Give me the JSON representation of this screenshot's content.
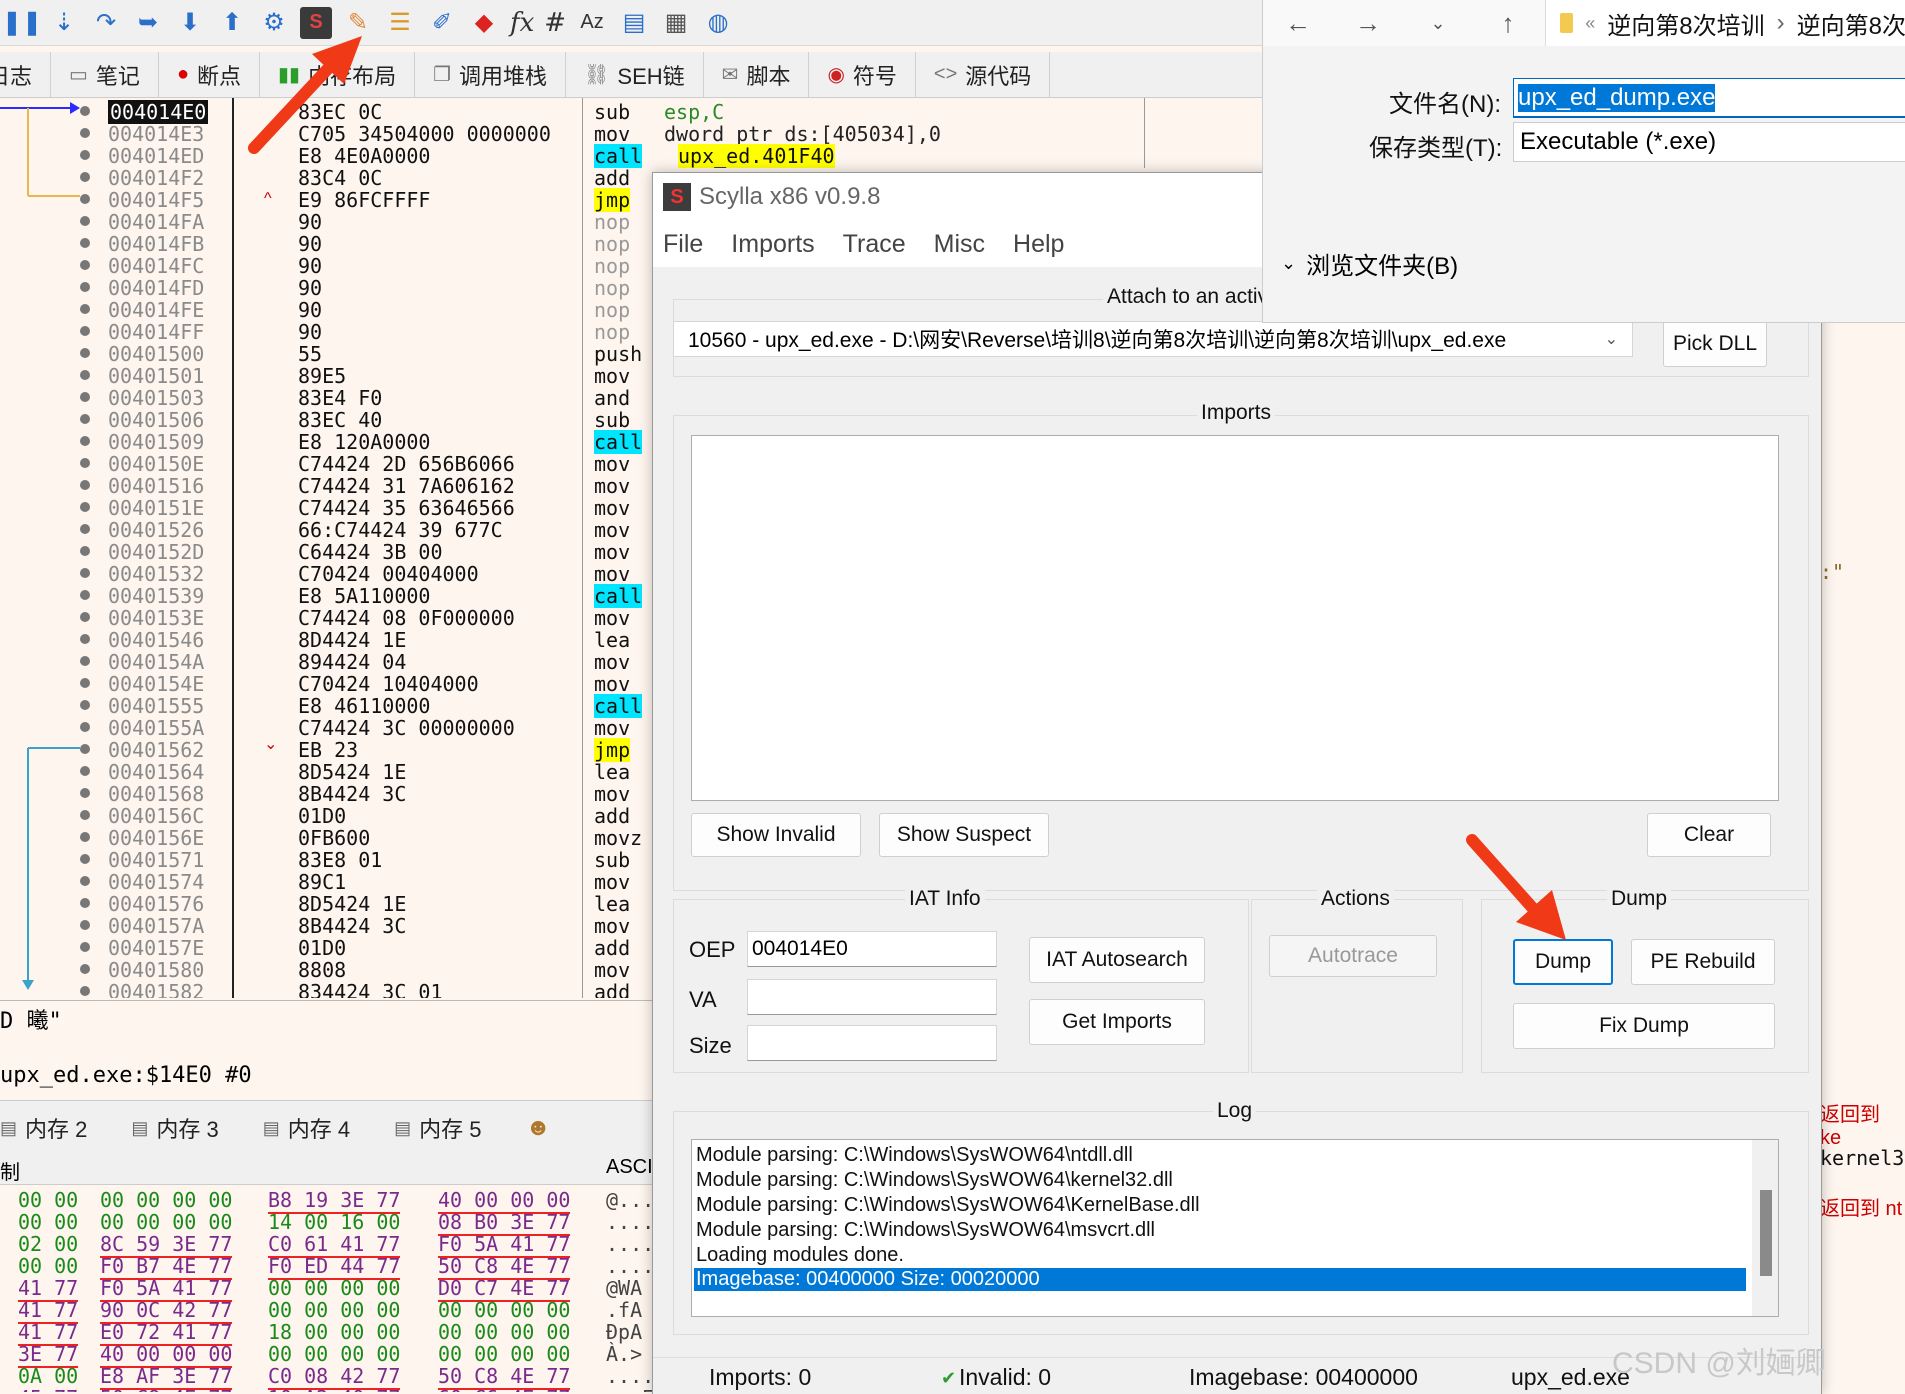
{
  "toolbar": {
    "items": [
      "pause-icon",
      "step-into-icon",
      "step-over-icon",
      "step-out-icon",
      "run-to-user-icon",
      "animate-icon",
      "user-icon",
      "scylla-icon",
      "patch-icon",
      "comment-icon",
      "label-icon",
      "bookmark-icon",
      "function-icon",
      "hash-icon",
      "font-icon",
      "memory-icon",
      "calculator-icon",
      "globe-icon"
    ],
    "fx": "fx",
    "hash": "#",
    "az": "Az"
  },
  "tabs": [
    {
      "icon": "log-icon",
      "label": "日志"
    },
    {
      "icon": "notes-icon",
      "label": "笔记"
    },
    {
      "icon": "breakpoint-icon",
      "label": "断点"
    },
    {
      "icon": "memory-map-icon",
      "label": "内存布局"
    },
    {
      "icon": "callstack-icon",
      "label": "调用堆栈"
    },
    {
      "icon": "seh-icon",
      "label": "SEH链"
    },
    {
      "icon": "script-icon",
      "label": "脚本"
    },
    {
      "icon": "symbol-icon",
      "label": "符号"
    },
    {
      "icon": "source-icon",
      "label": "源代码"
    }
  ],
  "disasm": [
    {
      "addr": "004014E0",
      "bytes": "83EC 0C",
      "mn": "sub",
      "op": "esp,C",
      "hl": ""
    },
    {
      "addr": "004014E3",
      "bytes": "C705 34504000 0000000",
      "mn": "mov",
      "op": "dword ptr ds:[405034],0",
      "hl": ""
    },
    {
      "addr": "004014ED",
      "bytes": "E8 4E0A0000",
      "mn": "call",
      "op": "upx_ed.401F40",
      "hl": "c"
    },
    {
      "addr": "004014F2",
      "bytes": "83C4 0C",
      "mn": "add",
      "op": "",
      "hl": ""
    },
    {
      "addr": "004014F5",
      "bytes": "E9 86FCFFFF",
      "mn": "jmp",
      "op": "",
      "hl": "y"
    },
    {
      "addr": "004014FA",
      "bytes": "90",
      "mn": "nop",
      "op": "",
      "hl": "n"
    },
    {
      "addr": "004014FB",
      "bytes": "90",
      "mn": "nop",
      "op": "",
      "hl": "n"
    },
    {
      "addr": "004014FC",
      "bytes": "90",
      "mn": "nop",
      "op": "",
      "hl": "n"
    },
    {
      "addr": "004014FD",
      "bytes": "90",
      "mn": "nop",
      "op": "",
      "hl": "n"
    },
    {
      "addr": "004014FE",
      "bytes": "90",
      "mn": "nop",
      "op": "",
      "hl": "n"
    },
    {
      "addr": "004014FF",
      "bytes": "90",
      "mn": "nop",
      "op": "",
      "hl": "n"
    },
    {
      "addr": "00401500",
      "bytes": "55",
      "mn": "push",
      "op": "",
      "hl": ""
    },
    {
      "addr": "00401501",
      "bytes": "89E5",
      "mn": "mov",
      "op": "",
      "hl": ""
    },
    {
      "addr": "00401503",
      "bytes": "83E4 F0",
      "mn": "and",
      "op": "",
      "hl": ""
    },
    {
      "addr": "00401506",
      "bytes": "83EC 40",
      "mn": "sub",
      "op": "",
      "hl": ""
    },
    {
      "addr": "00401509",
      "bytes": "E8 120A0000",
      "mn": "call",
      "op": "",
      "hl": "c"
    },
    {
      "addr": "0040150E",
      "bytes": "C74424 2D 656B6066",
      "mn": "mov",
      "op": "",
      "hl": ""
    },
    {
      "addr": "00401516",
      "bytes": "C74424 31 7A606162",
      "mn": "mov",
      "op": "",
      "hl": ""
    },
    {
      "addr": "0040151E",
      "bytes": "C74424 35 63646566",
      "mn": "mov",
      "op": "",
      "hl": ""
    },
    {
      "addr": "00401526",
      "bytes": "66:C74424 39 677C",
      "mn": "mov",
      "op": "",
      "hl": ""
    },
    {
      "addr": "0040152D",
      "bytes": "C64424 3B 00",
      "mn": "mov",
      "op": "",
      "hl": ""
    },
    {
      "addr": "00401532",
      "bytes": "C70424 00404000",
      "mn": "mov",
      "op": "",
      "hl": ""
    },
    {
      "addr": "00401539",
      "bytes": "E8 5A110000",
      "mn": "call",
      "op": "",
      "hl": "c"
    },
    {
      "addr": "0040153E",
      "bytes": "C74424 08 0F000000",
      "mn": "mov",
      "op": "",
      "hl": ""
    },
    {
      "addr": "00401546",
      "bytes": "8D4424 1E",
      "mn": "lea",
      "op": "",
      "hl": ""
    },
    {
      "addr": "0040154A",
      "bytes": "894424 04",
      "mn": "mov",
      "op": "",
      "hl": ""
    },
    {
      "addr": "0040154E",
      "bytes": "C70424 10404000",
      "mn": "mov",
      "op": "",
      "hl": ""
    },
    {
      "addr": "00401555",
      "bytes": "E8 46110000",
      "mn": "call",
      "op": "",
      "hl": "c"
    },
    {
      "addr": "0040155A",
      "bytes": "C74424 3C 00000000",
      "mn": "mov",
      "op": "",
      "hl": ""
    },
    {
      "addr": "00401562",
      "bytes": "EB 23",
      "mn": "jmp",
      "op": "",
      "hl": "y"
    },
    {
      "addr": "00401564",
      "bytes": "8D5424 1E",
      "mn": "lea",
      "op": "",
      "hl": ""
    },
    {
      "addr": "00401568",
      "bytes": "8B4424 3C",
      "mn": "mov",
      "op": "",
      "hl": ""
    },
    {
      "addr": "0040156C",
      "bytes": "01D0",
      "mn": "add",
      "op": "",
      "hl": ""
    },
    {
      "addr": "0040156E",
      "bytes": "0FB600",
      "mn": "movz",
      "op": "",
      "hl": ""
    },
    {
      "addr": "00401571",
      "bytes": "83E8 01",
      "mn": "sub",
      "op": "",
      "hl": ""
    },
    {
      "addr": "00401574",
      "bytes": "89C1",
      "mn": "mov",
      "op": "",
      "hl": ""
    },
    {
      "addr": "00401576",
      "bytes": "8D5424 1E",
      "mn": "lea",
      "op": "",
      "hl": ""
    },
    {
      "addr": "0040157A",
      "bytes": "8B4424 3C",
      "mn": "mov",
      "op": "",
      "hl": ""
    },
    {
      "addr": "0040157E",
      "bytes": "01D0",
      "mn": "add",
      "op": "",
      "hl": ""
    },
    {
      "addr": "00401580",
      "bytes": "8808",
      "mn": "mov",
      "op": "",
      "hl": ""
    },
    {
      "addr": "00401582",
      "bytes": "834424 3C 01",
      "mn": "add",
      "op": "",
      "hl": ""
    }
  ],
  "info": {
    "line1": "D 曦\"",
    "line2": "upx_ed.exe:$14E0 #0"
  },
  "right_fragments": [
    ":\"",
    "返回到 ke",
    "kernel32",
    "返回到 nt"
  ],
  "memtabs": [
    "内存 2",
    "内存 3",
    "内存 4",
    "内存 5"
  ],
  "hexhead": {
    "left": "制",
    "ascii": "ASCI"
  },
  "hex": [
    {
      "a": "00 00",
      "b": "00 00 00 00",
      "c": "B8 19 3E 77",
      "d": "40 00 00 00",
      "e": "@..."
    },
    {
      "a": "00 00",
      "b": "00 00 00 00",
      "c": "14 00 16 00",
      "d": "08 B0 3E 77",
      "e": "...."
    },
    {
      "a": "02 00",
      "b": "8C 59 3E 77",
      "c": "C0 61 41 77",
      "d": "F0 5A 41 77",
      "e": "...."
    },
    {
      "a": "00 00",
      "b": "F0 B7 4E 77",
      "c": "F0 ED 44 77",
      "d": "50 C8 4E 77",
      "e": "...."
    },
    {
      "a": "41 77",
      "b": "F0 5A 41 77",
      "c": "00 00 00 00",
      "d": "D0 C7 4E 77",
      "e": "@WA"
    },
    {
      "a": "41 77",
      "b": "90 0C 42 77",
      "c": "00 00 00 00",
      "d": "00 00 00 00",
      "e": ".fA"
    },
    {
      "a": "41 77",
      "b": "E0 72 41 77",
      "c": "18 00 00 00",
      "d": "00 00 00 00",
      "e": "ĐpA"
    },
    {
      "a": "3E 77",
      "b": "40 00 00 00",
      "c": "00 00 00 00",
      "d": "00 00 00 00",
      "e": "À.>"
    },
    {
      "a": "0A 00",
      "b": "E8 AF 3E 77",
      "c": "C0 08 42 77",
      "d": "50 C8 4E 77",
      "e": "...."
    },
    {
      "a": "45 77",
      "b": "50 C8 4E 77",
      "c": "10 A2 40 77",
      "d": "60 C6 4E 77",
      "e": "...E"
    }
  ],
  "scylla": {
    "title": "Scylla x86 v0.9.8",
    "menu": [
      "File",
      "Imports",
      "Trace",
      "Misc",
      "Help"
    ],
    "attach_label": "Attach to an active process",
    "process": "10560 - upx_ed.exe - D:\\网安\\Reverse\\培训8\\逆向第8次培训\\逆向第8次培训\\upx_ed.exe",
    "pick_dll": "Pick DLL",
    "imports_label": "Imports",
    "show_invalid": "Show Invalid",
    "show_suspect": "Show Suspect",
    "clear": "Clear",
    "iat_info_label": "IAT Info",
    "oep_label": "OEP",
    "oep_value": "004014E0",
    "va_label": "VA",
    "va_value": "",
    "size_label": "Size",
    "size_value": "",
    "iat_autosearch": "IAT Autosearch",
    "get_imports": "Get Imports",
    "actions_label": "Actions",
    "autotrace": "Autotrace",
    "dump_label": "Dump",
    "dump": "Dump",
    "pe_rebuild": "PE Rebuild",
    "fix_dump": "Fix Dump",
    "log_label": "Log",
    "log": [
      "Module parsing: C:\\Windows\\SysWOW64\\ntdll.dll",
      "Module parsing: C:\\Windows\\SysWOW64\\kernel32.dll",
      "Module parsing: C:\\Windows\\SysWOW64\\KernelBase.dll",
      "Module parsing: C:\\Windows\\SysWOW64\\msvcrt.dll",
      "Loading modules done.",
      "Imagebase: 00400000 Size: 00020000"
    ],
    "status": {
      "imports": "Imports: 0",
      "invalid": "Invalid: 0",
      "imagebase": "Imagebase: 00400000",
      "module": "upx_ed.exe"
    }
  },
  "save_dialog": {
    "breadcrumb": [
      "«",
      "逆向第8次培训",
      "›",
      "逆向第8次"
    ],
    "filename_label": "文件名(N):",
    "filename_value": "upx_ed_dump.exe",
    "filetype_label": "保存类型(T):",
    "filetype_value": "Executable (*.exe)",
    "browse_folders": "浏览文件夹(B)"
  },
  "watermark": "CSDN @刘婳卿"
}
